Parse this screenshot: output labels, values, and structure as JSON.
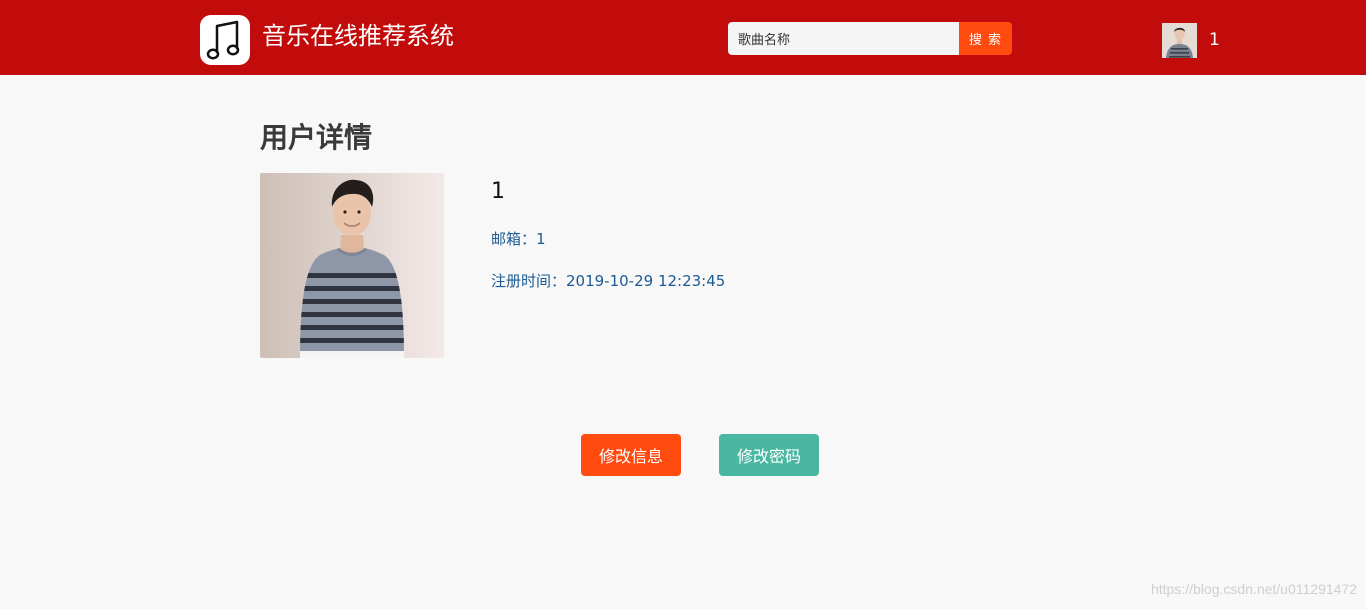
{
  "header": {
    "logo_icon": "music-note-icon",
    "brand_title": "音乐在线推荐系统",
    "search": {
      "value": "歌曲名称",
      "placeholder": "歌曲名称",
      "button_label": "搜 索"
    },
    "user": {
      "avatar_icon": "user-avatar",
      "username": "1"
    }
  },
  "main": {
    "page_title": "用户详情",
    "profile": {
      "photo": "user-photo",
      "name": "1",
      "email_line": "邮箱：1",
      "register_time_line": "注册时间：2019-10-29 12:23:45"
    },
    "actions": {
      "edit_info_label": "修改信息",
      "change_password_label": "修改密码"
    }
  },
  "footer": {
    "watermark": "https://blog.csdn.net/u011291472"
  },
  "colors": {
    "header_bg": "#c20c0c",
    "accent_orange": "#ff4a10",
    "accent_teal": "#4ab7a0",
    "link_blue": "#1d5a94"
  }
}
